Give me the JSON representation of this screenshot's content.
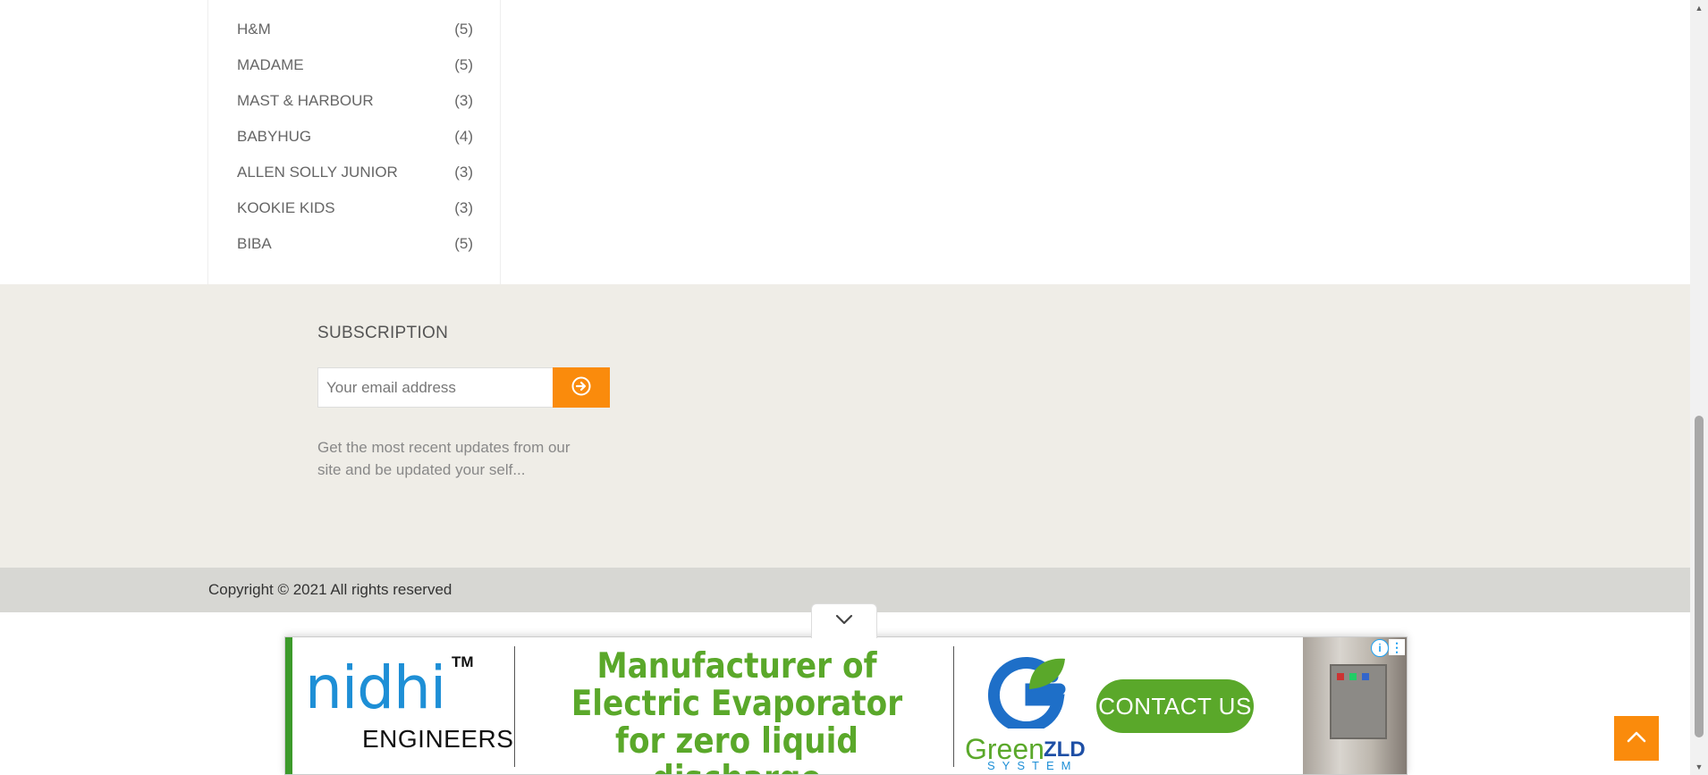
{
  "brands": [
    {
      "name": "H&M",
      "count": "(5)"
    },
    {
      "name": "MADAME",
      "count": "(5)"
    },
    {
      "name": "MAST & HARBOUR",
      "count": "(3)"
    },
    {
      "name": "BABYHUG",
      "count": "(4)"
    },
    {
      "name": "ALLEN SOLLY JUNIOR",
      "count": "(3)"
    },
    {
      "name": "KOOKIE KIDS",
      "count": "(3)"
    },
    {
      "name": "BIBA",
      "count": "(5)"
    }
  ],
  "subscription": {
    "title": "SUBSCRIPTION",
    "email_placeholder": "Your email address",
    "submit_icon": "arrow-circle-right-icon",
    "description": "Get the most recent updates from our site and be updated your self..."
  },
  "footer": {
    "copyright": "Copyright © 2021 All rights reserved"
  },
  "ad": {
    "toggle_icon": "chevron-down-icon",
    "brand_word": "nidhi",
    "brand_tm": "TM",
    "brand_sub": "ENGINEERS",
    "headline": "Manufacturer of Electric Evaporator for zero liquid discharge",
    "partner_word": "Green",
    "partner_zld": "ZLD",
    "partner_system": "SYSTEM",
    "cta_label": "CONTACT US",
    "info_icon": "info-icon",
    "menu_icon": "more-vertical-icon"
  },
  "colors": {
    "accent": "#fa8b0c",
    "subscription_bg": "#efede7",
    "copyright_bg": "#d7d7d3",
    "ad_green": "#5aa82a",
    "ad_blue": "#1e8fd6"
  },
  "back_to_top": {
    "icon": "chevron-up-icon"
  }
}
